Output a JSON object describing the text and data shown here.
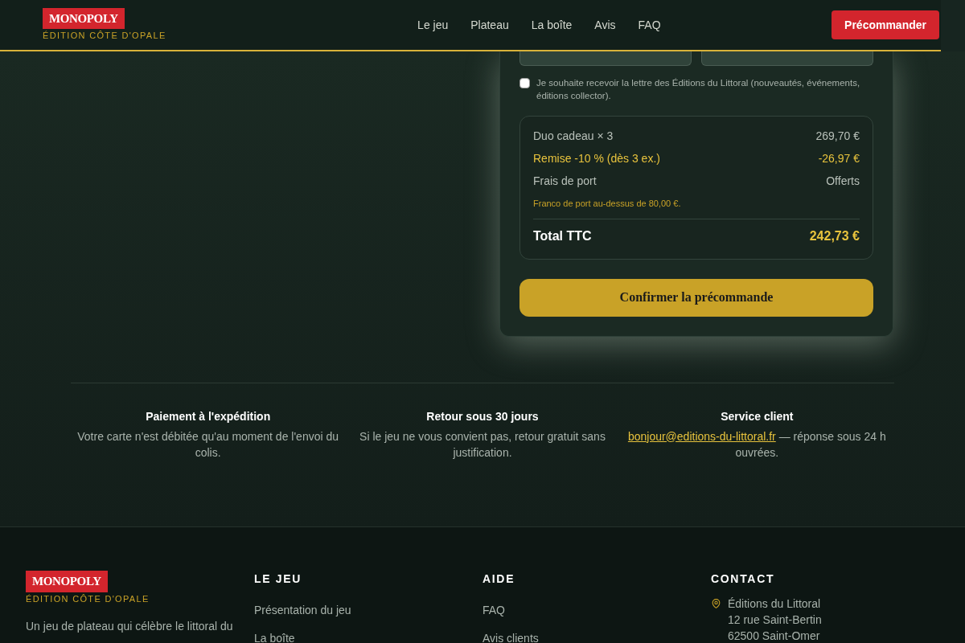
{
  "brand": {
    "logo": "MONOPOLY",
    "tagline": "ÉDITION CÔTE D'OPALE"
  },
  "nav": {
    "links": [
      "Le jeu",
      "Plateau",
      "La boîte",
      "Avis",
      "FAQ"
    ],
    "cta": "Précommander"
  },
  "form": {
    "newsletter": {
      "label": "Je souhaite recevoir la lettre des Éditions du Littoral (nouveautés, événements, éditions collector).",
      "checked": false
    },
    "summary": {
      "lines": [
        {
          "label": "Duo cadeau × 3",
          "amount": "269,70 €",
          "kind": "normal"
        },
        {
          "label": "Remise -10 % (dès 3 ex.)",
          "amount": "-26,97 €",
          "kind": "discount"
        },
        {
          "label": "Frais de port",
          "amount": "Offerts",
          "kind": "normal"
        }
      ],
      "note": "Franco de port au-dessus de 80,00 €.",
      "total_label": "Total TTC",
      "total": "242,73 €"
    },
    "submit": "Confirmer la précommande"
  },
  "features": [
    {
      "title": "Paiement à l'expédition",
      "text": "Votre carte n'est débitée qu'au moment de l'envoi du colis."
    },
    {
      "title": "Retour sous 30 jours",
      "text": "Si le jeu ne vous convient pas, retour gratuit sans justification."
    },
    {
      "title": "Service client",
      "link": "bonjour@editions-du-littoral.fr",
      "text": " — réponse sous 24 h ouvrées."
    }
  ],
  "footer": {
    "brand": {
      "logo": "MONOPOLY",
      "tagline": "ÉDITION CÔTE D'OPALE"
    },
    "about": "Un jeu de plateau qui célèbre le littoral du",
    "columns": [
      {
        "title": "LE JEU",
        "links": [
          "Présentation du jeu",
          "La boîte"
        ]
      },
      {
        "title": "AIDE",
        "links": [
          "FAQ",
          "Avis clients"
        ]
      }
    ],
    "contact": {
      "title": "CONTACT",
      "address": [
        "Éditions du Littoral",
        "12 rue Saint-Bertin",
        "62500 Saint-Omer"
      ]
    }
  }
}
